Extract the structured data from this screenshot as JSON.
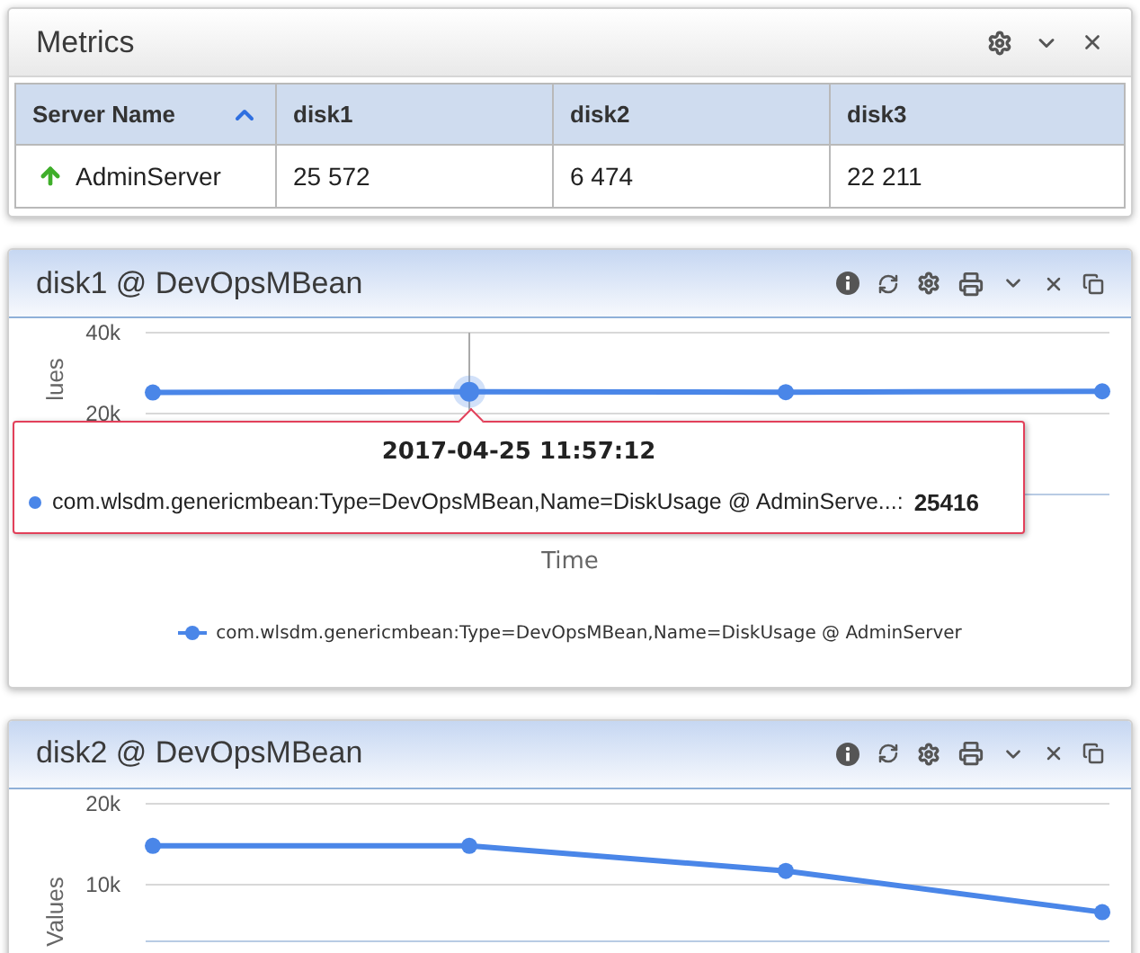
{
  "metrics_panel": {
    "title": "Metrics",
    "table": {
      "columns": [
        {
          "label": "Server Name",
          "sorted": true
        },
        {
          "label": "disk1",
          "sorted": false
        },
        {
          "label": "disk2",
          "sorted": false
        },
        {
          "label": "disk3",
          "sorted": false
        }
      ],
      "rows": [
        {
          "running": true,
          "cells": [
            "AdminServer",
            "25 572",
            "6 474",
            "22 211"
          ]
        }
      ]
    }
  },
  "chart_panels": [
    {
      "title": "disk1 @ DevOpsMBean",
      "chart_data": {
        "type": "line",
        "xlabel": "Time",
        "ylabel": "lues",
        "ylim": [
          0,
          40000
        ],
        "yticks": [
          {
            "value": 20000,
            "label": "20k"
          },
          {
            "value": 40000,
            "label": "40k"
          }
        ],
        "series": [
          {
            "name": "com.wlsdm.genericmbean:Type=DevOpsMBean,Name=DiskUsage @ AdminServer",
            "color": "#4a86e8",
            "marker": "circle",
            "values": [
              25200,
              25416,
              25300,
              25500
            ]
          }
        ]
      },
      "tooltip": {
        "time": "2017-04-25 11:57:12",
        "series": "com.wlsdm.genericmbean:Type=DevOpsMBean,Name=DiskUsage @ AdminServe...:",
        "value": "25416"
      }
    },
    {
      "title": "disk2 @ DevOpsMBean",
      "chart_data": {
        "type": "line",
        "ylabel": "Values",
        "ylim": [
          3000,
          20000
        ],
        "yticks": [
          {
            "value": 10000,
            "label": "10k"
          },
          {
            "value": 20000,
            "label": "20k"
          }
        ],
        "series": [
          {
            "color": "#4a86e8",
            "marker": "circle",
            "values": [
              14800,
              14800,
              11700,
              6600
            ]
          }
        ]
      }
    }
  ]
}
